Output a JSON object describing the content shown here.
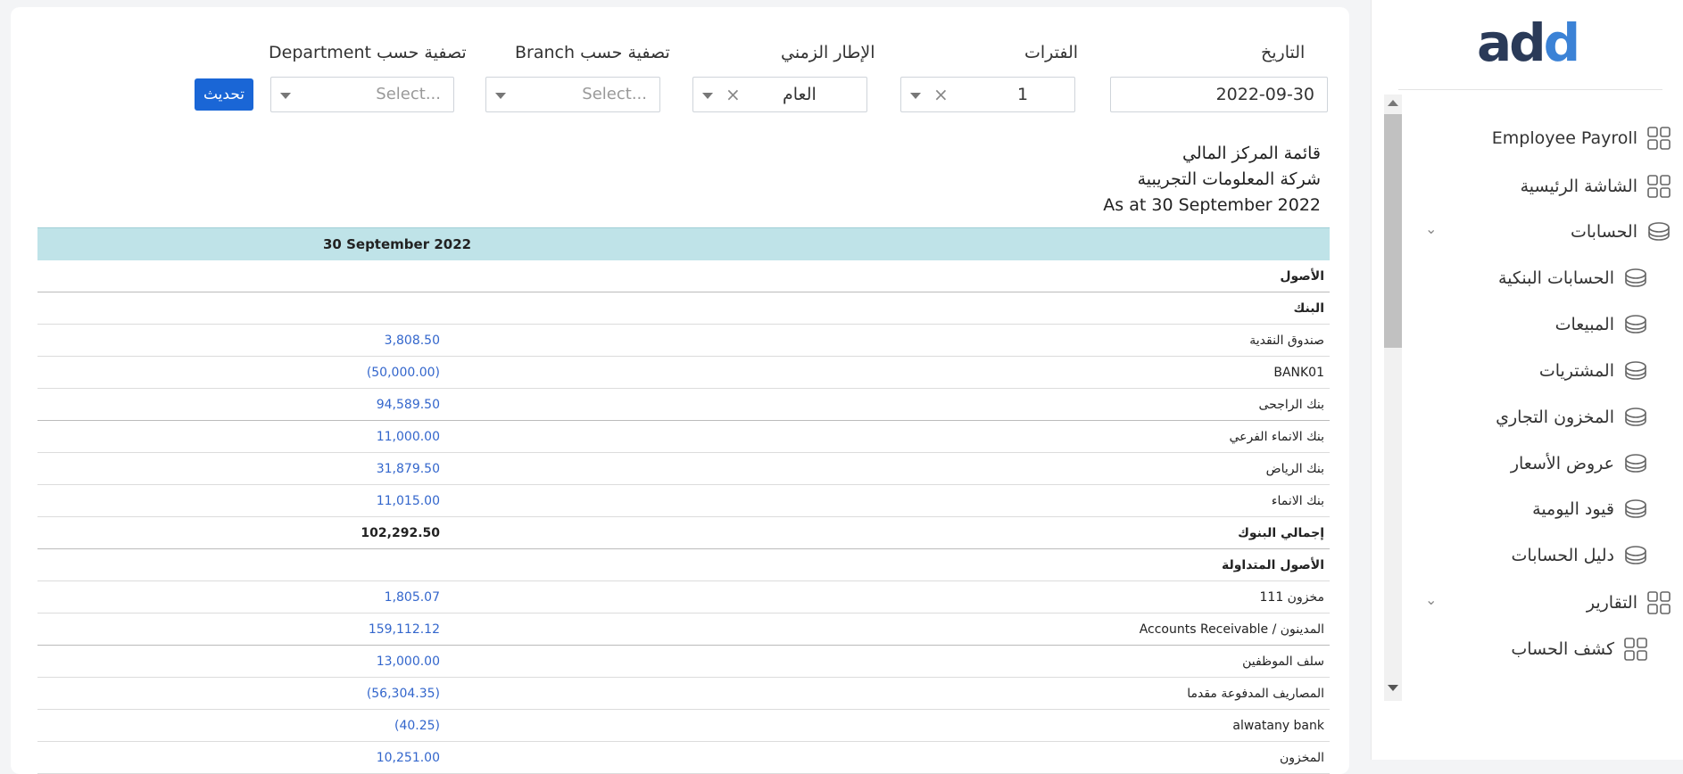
{
  "filters": {
    "date_label": "التاريخ",
    "date_value": "2022-09-30",
    "periods_label": "الفترات",
    "periods_value": "1",
    "timeframe_label": "الإطار الزمني",
    "timeframe_value": "العام",
    "branch_label": "تصفية حسب Branch",
    "branch_placeholder": "Select...",
    "department_label": "تصفية حسب Department",
    "department_placeholder": "Select...",
    "refresh_label": "تحديث"
  },
  "report": {
    "title": "قائمة المركز المالي",
    "company": "شركة المعلومات التجريبية",
    "as_at": "As at 30 September 2022",
    "column_header": "30 September 2022",
    "rows": [
      {
        "label": "الأصول",
        "amount": "",
        "bold": true
      },
      {
        "label": "البنك",
        "amount": "",
        "bold": true
      },
      {
        "label": "صندوق النقدية",
        "amount": "3,808.50",
        "bold": false
      },
      {
        "label": "BANK01",
        "amount": "(50,000.00)",
        "bold": false
      },
      {
        "label": "بنك الراجحى",
        "amount": "94,589.50",
        "bold": false
      },
      {
        "label": "بنك الانماء الفرعي",
        "amount": "11,000.00",
        "bold": false
      },
      {
        "label": "بنك الرياض",
        "amount": "31,879.50",
        "bold": false
      },
      {
        "label": "بنك الانماء",
        "amount": "11,015.00",
        "bold": false
      },
      {
        "label": "إجمالي البنوك",
        "amount": "102,292.50",
        "bold": true
      },
      {
        "label": "الأصول المتداولة",
        "amount": "",
        "bold": true
      },
      {
        "label": "مخزون 111",
        "amount": "1,805.07",
        "bold": false
      },
      {
        "label": "Accounts Receivable / المدينون",
        "amount": "159,112.12",
        "bold": false
      },
      {
        "label": "سلف الموظفين",
        "amount": "13,000.00",
        "bold": false
      },
      {
        "label": "المصاريف المدفوعة مقدما",
        "amount": "(56,304.35)",
        "bold": false
      },
      {
        "label": "alwatany bank",
        "amount": "(40.25)",
        "bold": false
      },
      {
        "label": "المخزون",
        "amount": "10,251.00",
        "bold": false
      }
    ]
  },
  "sidebar": {
    "logo_text_dark": "ad",
    "logo_text_blue": "d",
    "items": [
      {
        "label": "Employee Payroll",
        "icon": "grid-icon"
      },
      {
        "label": "الشاشة الرئيسية",
        "icon": "grid-icon"
      },
      {
        "label": "الحسابات",
        "icon": "stack-icon"
      },
      {
        "label": "الحسابات البنكية",
        "icon": "stack-icon"
      },
      {
        "label": "المبيعات",
        "icon": "stack-icon"
      },
      {
        "label": "المشتريات",
        "icon": "stack-icon"
      },
      {
        "label": "المخزون التجاري",
        "icon": "stack-icon"
      },
      {
        "label": "عروض الأسعار",
        "icon": "stack-icon"
      },
      {
        "label": "قيود اليومية",
        "icon": "stack-icon"
      },
      {
        "label": "دليل الحسابات",
        "icon": "stack-icon"
      },
      {
        "label": "التقارير",
        "icon": "grid-icon"
      },
      {
        "label": "كشف الحساب",
        "icon": "grid-icon"
      }
    ]
  },
  "colors": {
    "accent": "#1a66d6",
    "header_bg": "#bfe3e8",
    "amount": "#3366cc"
  }
}
